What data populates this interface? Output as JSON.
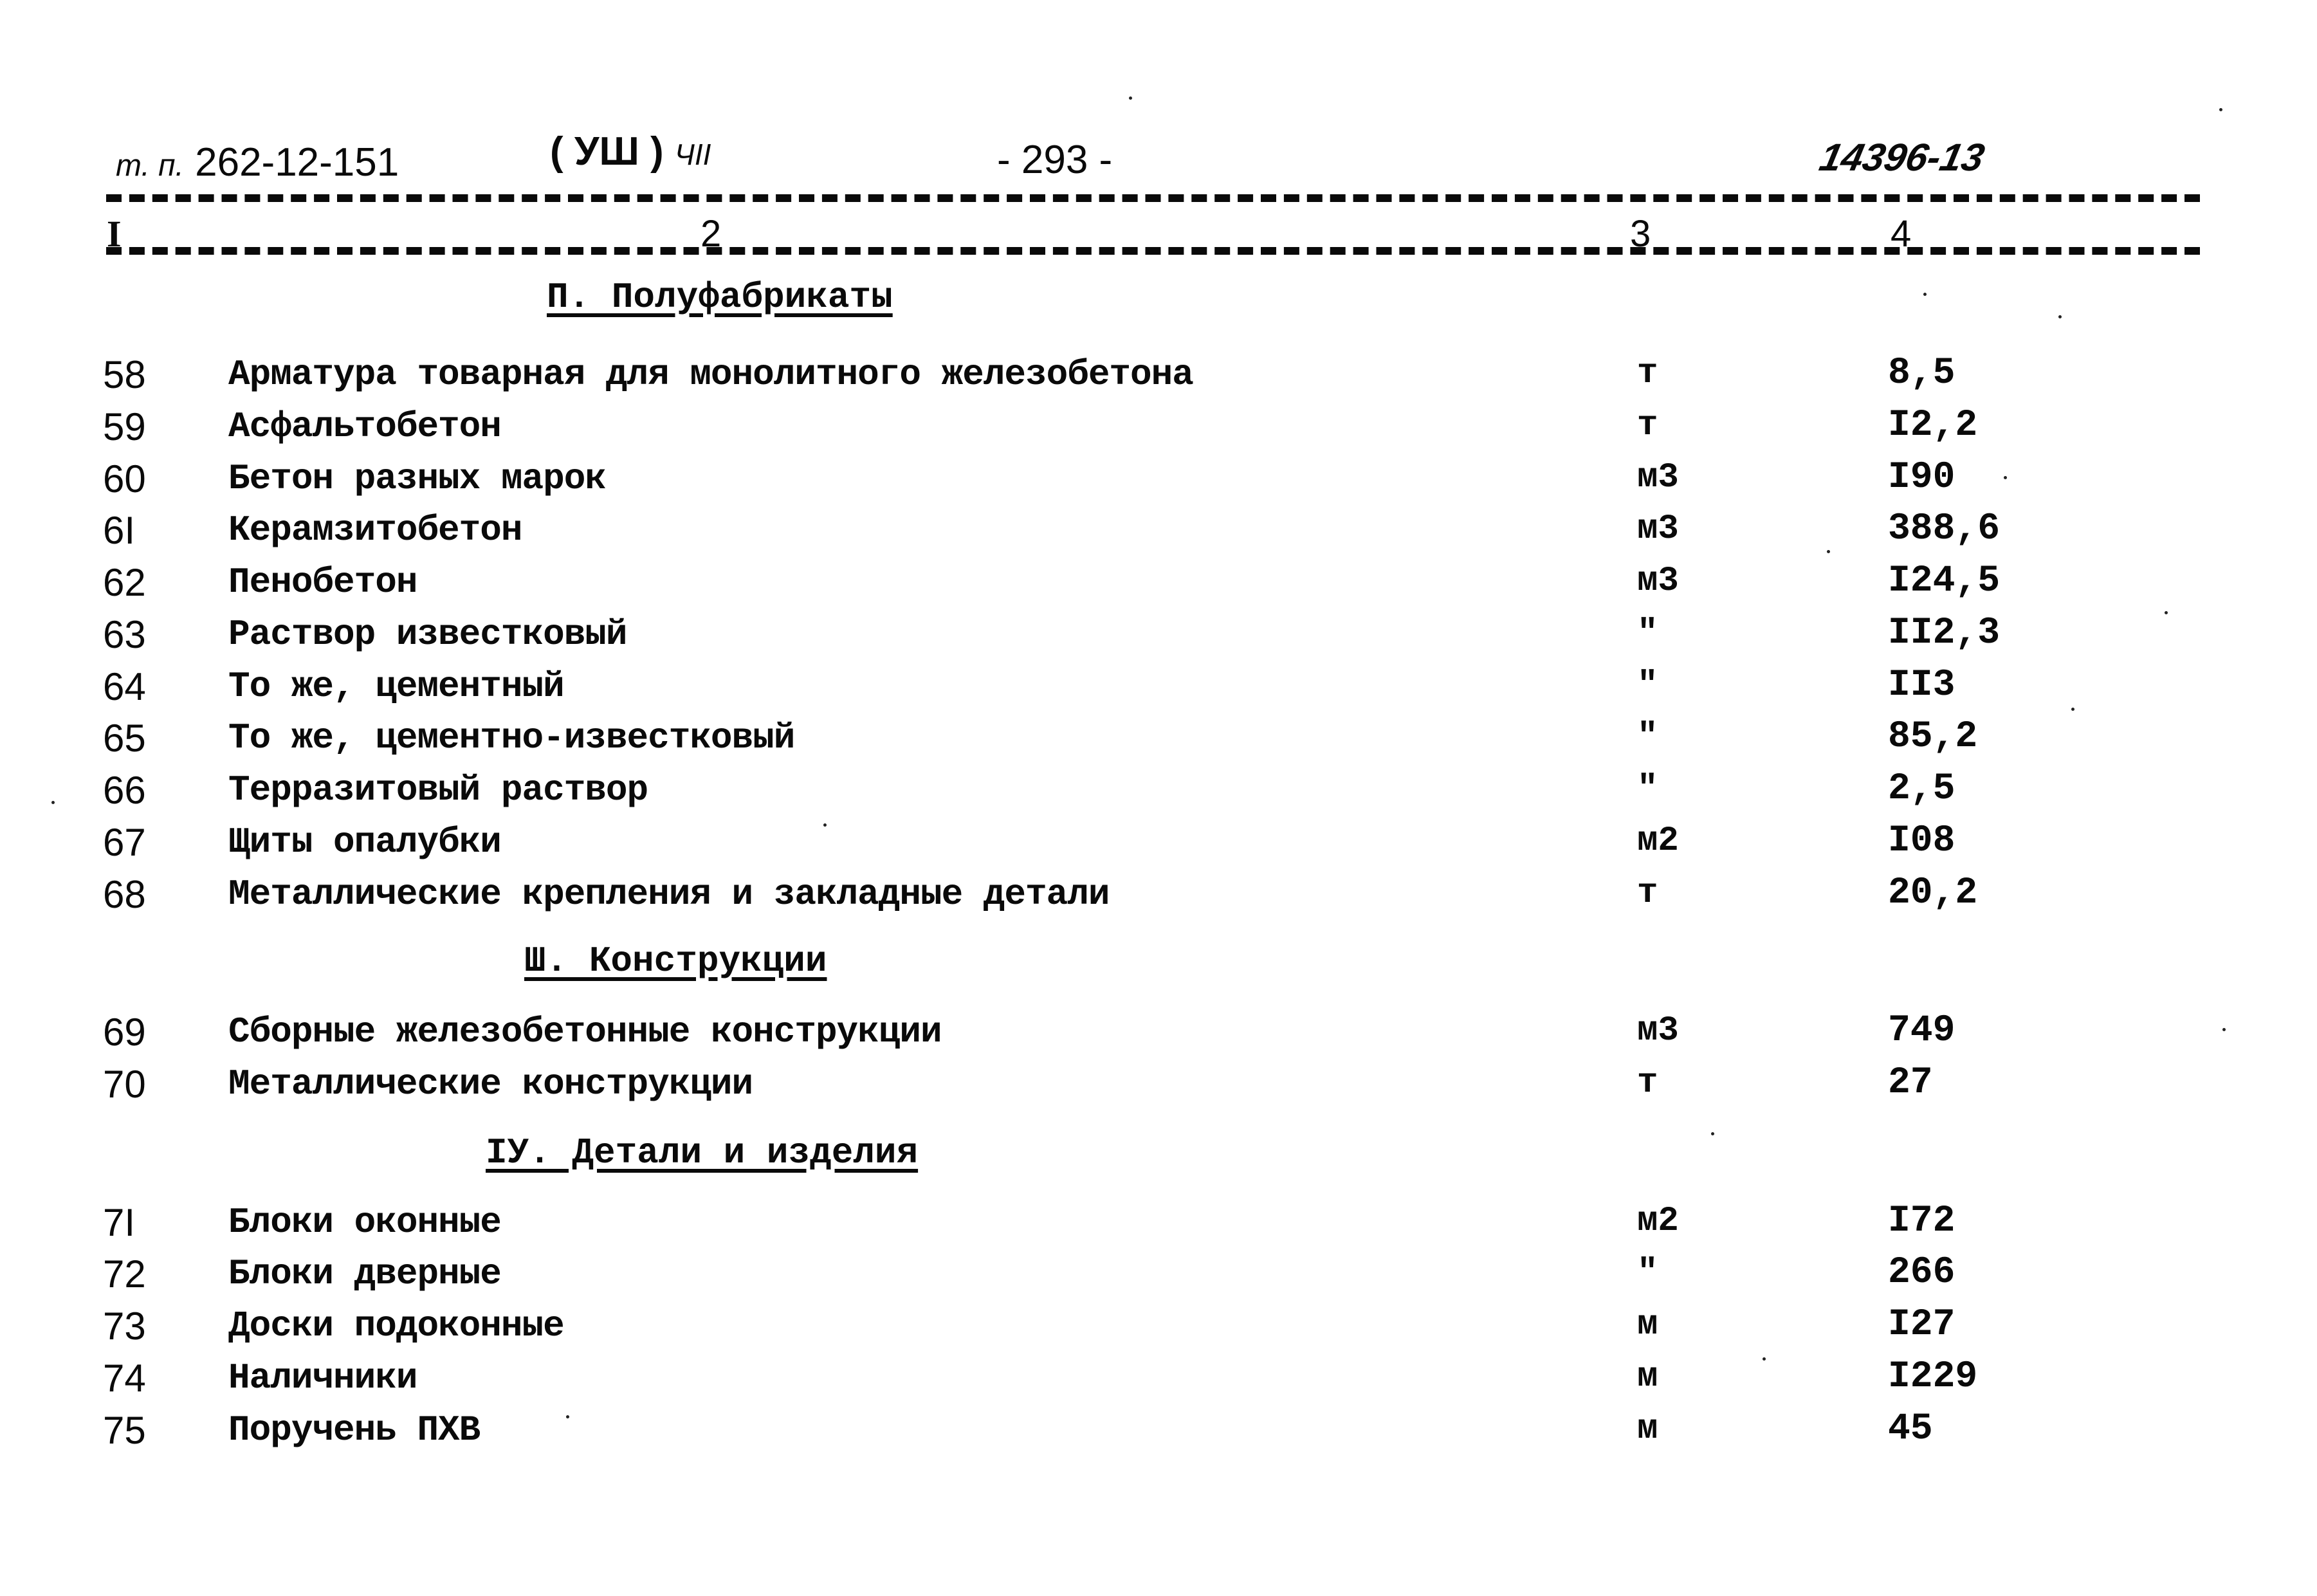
{
  "header": {
    "doc_prefix": "т. п.",
    "doc_number": "262-12-151",
    "volume": "( УШ )",
    "volume_note": "ЧII",
    "page_number": "- 293 -",
    "inventory_number": "14396-13"
  },
  "columns": [
    "I",
    "2",
    "3",
    "4"
  ],
  "sections": [
    {
      "title": "П. Полуфабрикаты",
      "rows": [
        {
          "num": "58",
          "name": "Арматура товарная для монолитного железобетона",
          "unit": "т",
          "value": "8,5"
        },
        {
          "num": "59",
          "name": "Асфальтобетон",
          "unit": "т",
          "value": "I2,2"
        },
        {
          "num": "60",
          "name": "Бетон разных марок",
          "unit": "м3",
          "value": "I90"
        },
        {
          "num": "6I",
          "name": "Керамзитобетон",
          "unit": "м3",
          "value": "388,6"
        },
        {
          "num": "62",
          "name": "Пенобетон",
          "unit": "м3",
          "value": "I24,5"
        },
        {
          "num": "63",
          "name": "Раствор известковый",
          "unit": "\"",
          "value": "II2,3"
        },
        {
          "num": "64",
          "name": "То же, цементный",
          "unit": "\"",
          "value": "II3"
        },
        {
          "num": "65",
          "name": "То же, цементно-известковый",
          "unit": "\"",
          "value": "85,2"
        },
        {
          "num": "66",
          "name": "Терразитовый раствор",
          "unit": "\"",
          "value": "2,5"
        },
        {
          "num": "67",
          "name": "Щиты опалубки",
          "unit": "м2",
          "value": "I08"
        },
        {
          "num": "68",
          "name": "Металлические крепления и закладные детали",
          "unit": "т",
          "value": "20,2"
        }
      ]
    },
    {
      "title": "Ш. Конструкции",
      "rows": [
        {
          "num": "69",
          "name": "Сборные железобетонные конструкции",
          "unit": "м3",
          "value": "749"
        },
        {
          "num": "70",
          "name": "Металлические конструкции",
          "unit": "т",
          "value": "27"
        }
      ]
    },
    {
      "title": "IУ. Детали и изделия",
      "rows": [
        {
          "num": "7I",
          "name": "Блоки оконные",
          "unit": "м2",
          "value": "I72"
        },
        {
          "num": "72",
          "name": "Блоки дверные",
          "unit": "\"",
          "value": "266"
        },
        {
          "num": "73",
          "name": "Доски подоконные",
          "unit": "м",
          "value": "I27"
        },
        {
          "num": "74",
          "name": "Наличники",
          "unit": "м",
          "value": "I229"
        },
        {
          "num": "75",
          "name": "Поручень ПХВ",
          "unit": "м",
          "value": "45"
        }
      ]
    }
  ]
}
